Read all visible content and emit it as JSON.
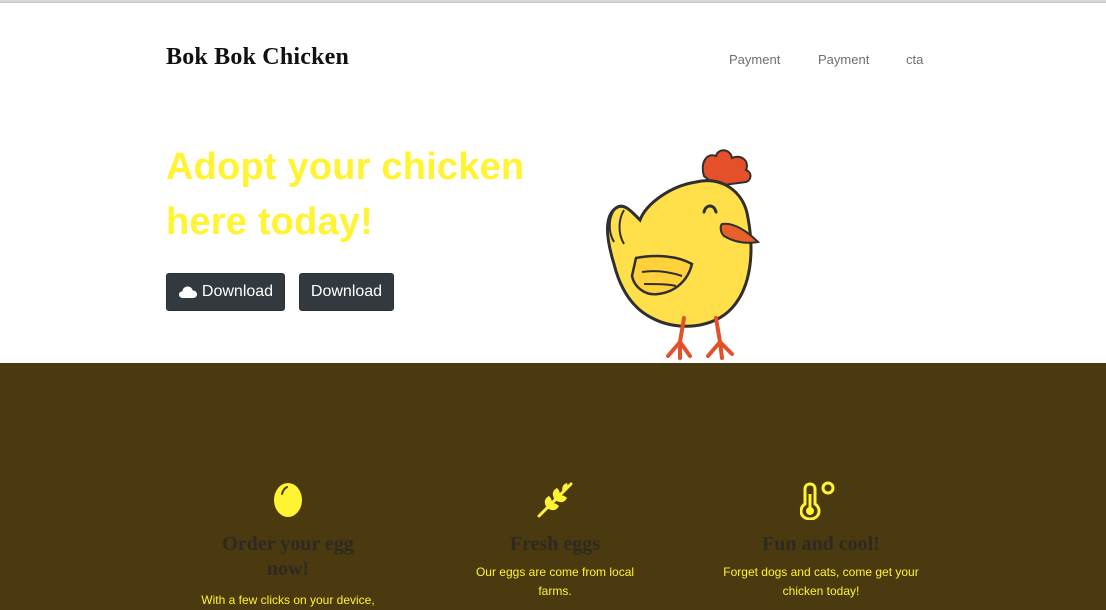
{
  "brand": {
    "name": "Bok Bok Chicken"
  },
  "nav": {
    "items": [
      "Payment",
      "Payment",
      "cta"
    ]
  },
  "hero": {
    "title": "Adopt your chicken here today!",
    "buttons": [
      {
        "label": "Download",
        "icon": "cloud-icon"
      },
      {
        "label": "Download"
      }
    ],
    "image": "chicken-illustration"
  },
  "features": [
    {
      "icon": "egg-icon",
      "title": "Order your egg now!",
      "text": "With a few clicks on your device,"
    },
    {
      "icon": "wheat-icon",
      "title": "Fresh eggs",
      "text": "Our eggs are come from local farms."
    },
    {
      "icon": "thermometer-icon",
      "title": "Fun and cool!",
      "text": "Forget dogs and cats, come get your chicken today!"
    }
  ],
  "colors": {
    "accent_yellow": "#fff332",
    "band_brown": "#4b3a0f",
    "button_dark": "#333a3f"
  }
}
